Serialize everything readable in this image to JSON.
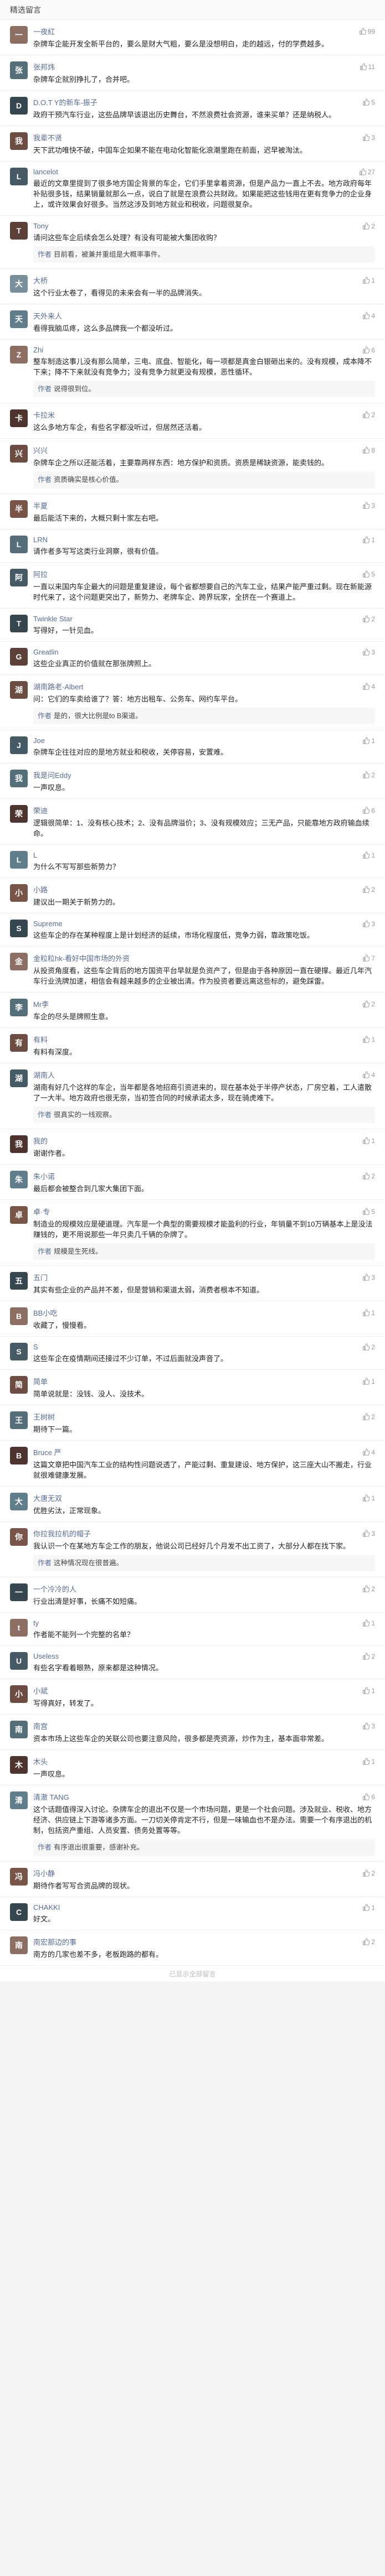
{
  "header": {
    "title": "精选留言"
  },
  "comments": [
    {
      "id": 1,
      "nickname": "一夜紅",
      "avatar_color": "#8d6e63",
      "avatar_text": "一",
      "likes": "99",
      "text": "杂牌车企能开发全新平台的，要么是财大气粗，要么是没想明白，走的越远，付的学费越多。"
    },
    {
      "id": 2,
      "nickname": "张邦炜",
      "avatar_color": "#546e7a",
      "avatar_text": "张",
      "likes": "11",
      "text": "杂牌车企就别挣扎了，合并吧。"
    },
    {
      "id": 3,
      "nickname": "D.O.T Y的新车-振子",
      "avatar_color": "#37474f",
      "avatar_text": "D",
      "likes": "5",
      "text": "政府干预汽车行业，这些品牌早该退出历史舞台，不然浪费社会资源，谁来买单？还是纳税人。"
    },
    {
      "id": 4,
      "nickname": "我辈不贤",
      "avatar_color": "#6d4c41",
      "avatar_text": "我",
      "likes": "3",
      "text": "天下武功唯快不破，中国车企如果不能在电动化智能化浪潮里跑在前面，迟早被淘汰。"
    },
    {
      "id": 5,
      "nickname": "lancelot",
      "avatar_color": "#455a64",
      "avatar_text": "L",
      "likes": "27",
      "text": "最近的文章里提到了很多地方国企背景的车企，它们手里拿着资源，但是产品力一直上不去。地方政府每年补贴很多钱，结果销量就那么一点，说白了就是在浪费公共财政。如果能把这些钱用在更有竞争力的企业身上，或许效果会好很多。当然这涉及到地方就业和税收，问题很复杂。"
    },
    {
      "id": 6,
      "nickname": "Tony",
      "avatar_color": "#5d4037",
      "avatar_text": "T",
      "likes": "2",
      "text": "请问这些车企后续会怎么处理？有没有可能被大集团收购？",
      "author_reply": "目前看，被兼并重组是大概率事件。"
    },
    {
      "id": 7,
      "nickname": "大桥",
      "avatar_color": "#78909c",
      "avatar_text": "大",
      "likes": "1",
      "text": "这个行业太卷了，看得见的未来会有一半的品牌消失。"
    },
    {
      "id": 8,
      "nickname": "天外来人",
      "avatar_color": "#607d8b",
      "avatar_text": "天",
      "likes": "4",
      "text": "看得我脑瓜疼，这么多品牌我一个都没听过。"
    },
    {
      "id": 9,
      "nickname": "Zhi",
      "avatar_color": "#8d6e63",
      "avatar_text": "Z",
      "likes": "6",
      "text": "整车制造这事儿没有那么简单，三电、底盘、智能化，每一项都是真金白银砸出来的。没有规模，成本降不下来；降不下来就没有竞争力；没有竞争力就更没有规模，恶性循环。",
      "author_reply": "说得很到位。"
    },
    {
      "id": 10,
      "nickname": "卡拉米",
      "avatar_color": "#4e342e",
      "avatar_text": "卡",
      "likes": "2",
      "text": "这么多地方车企，有些名字都没听过，但居然还活着。"
    },
    {
      "id": 11,
      "nickname": "兴兴",
      "avatar_color": "#6d4c41",
      "avatar_text": "兴",
      "likes": "8",
      "text": "杂牌车企之所以还能活着，主要靠两样东西：地方保护和资质。资质是稀缺资源，能卖钱的。",
      "author_reply": "资质确实是核心价值。"
    },
    {
      "id": 12,
      "nickname": "半夏",
      "avatar_color": "#795548",
      "avatar_text": "半",
      "likes": "3",
      "text": "最后能活下来的，大概只剩十家左右吧。"
    },
    {
      "id": 13,
      "nickname": "LRN",
      "avatar_color": "#546e7a",
      "avatar_text": "L",
      "likes": "1",
      "text": "请作者多写写这类行业洞察，很有价值。"
    },
    {
      "id": 14,
      "nickname": "阿拉",
      "avatar_color": "#455a64",
      "avatar_text": "阿",
      "likes": "5",
      "text": "一直以来国内车企最大的问题是重复建设，每个省都想要自己的汽车工业，结果产能严重过剩。现在新能源时代来了，这个问题更突出了，新势力、老牌车企、跨界玩家，全挤在一个赛道上。"
    },
    {
      "id": 15,
      "nickname": "Twinkle Star",
      "avatar_color": "#37474f",
      "avatar_text": "T",
      "likes": "2",
      "text": "写得好，一针见血。"
    },
    {
      "id": 16,
      "nickname": "Greatlin",
      "avatar_color": "#5d4037",
      "avatar_text": "G",
      "likes": "3",
      "text": "这些企业真正的价值就在那张牌照上。"
    },
    {
      "id": 17,
      "nickname": "湖南路老·Albert",
      "avatar_color": "#6d4c41",
      "avatar_text": "湖",
      "likes": "4",
      "text": "问：它们的车卖给谁了？答：地方出租车、公务车、网约车平台。",
      "author_reply": "是的，很大比例是to B渠道。"
    },
    {
      "id": 18,
      "nickname": "Joe",
      "avatar_color": "#455a64",
      "avatar_text": "J",
      "likes": "1",
      "text": "杂牌车企往往对应的是地方就业和税收，关停容易，安置难。"
    },
    {
      "id": 19,
      "nickname": "我是问Eddy",
      "avatar_color": "#546e7a",
      "avatar_text": "我",
      "likes": "2",
      "text": "一声叹息。"
    },
    {
      "id": 20,
      "nickname": "荣迪",
      "avatar_color": "#4e342e",
      "avatar_text": "荣",
      "likes": "6",
      "text": "逻辑很简单：1、没有核心技术；2、没有品牌溢价；3、没有规模效应；三无产品，只能靠地方政府输血续命。"
    },
    {
      "id": 21,
      "nickname": "L",
      "avatar_color": "#607d8b",
      "avatar_text": "L",
      "likes": "1",
      "text": "为什么不写写那些新势力？"
    },
    {
      "id": 22,
      "nickname": "小路",
      "avatar_color": "#795548",
      "avatar_text": "小",
      "likes": "2",
      "text": "建议出一期关于新势力的。"
    },
    {
      "id": 23,
      "nickname": "Supreme",
      "avatar_color": "#37474f",
      "avatar_text": "S",
      "likes": "3",
      "text": "这些车企的存在某种程度上是计划经济的延续，市场化程度低，竞争力弱，靠政策吃饭。"
    },
    {
      "id": 24,
      "nickname": "金粒粒hk-看好中国市场的外资",
      "avatar_color": "#8d6e63",
      "avatar_text": "金",
      "likes": "7",
      "text": "从投资角度看，这些车企背后的地方国资平台早就是负资产了，但是由于各种原因一直在硬撑。最近几年汽车行业洗牌加速，相信会有越来越多的企业被出清。作为投资者要远离这些标的，避免踩雷。"
    },
    {
      "id": 25,
      "nickname": "Mr李",
      "avatar_color": "#546e7a",
      "avatar_text": "李",
      "likes": "2",
      "text": "车企的尽头是牌照生意。"
    },
    {
      "id": 26,
      "nickname": "有料",
      "avatar_color": "#6d4c41",
      "avatar_text": "有",
      "likes": "1",
      "text": "有料有深度。"
    },
    {
      "id": 27,
      "nickname": "湖南人",
      "avatar_color": "#455a64",
      "avatar_text": "湖",
      "likes": "4",
      "text": "湖南有好几个这样的车企，当年都是各地招商引资进来的，现在基本处于半停产状态，厂房空着，工人遣散了一大半。地方政府也很无奈，当初签合同的时候承诺太多，现在骑虎难下。",
      "author_reply": "很真实的一线观察。"
    },
    {
      "id": 28,
      "nickname": "我的",
      "avatar_color": "#4e342e",
      "avatar_text": "我",
      "likes": "1",
      "text": "谢谢作者。"
    },
    {
      "id": 29,
      "nickname": "朱小诺",
      "avatar_color": "#607d8b",
      "avatar_text": "朱",
      "likes": "2",
      "text": "最后都会被整合到几家大集团下面。"
    },
    {
      "id": 30,
      "nickname": "卓·专",
      "avatar_color": "#795548",
      "avatar_text": "卓",
      "likes": "5",
      "text": "制造业的规模效应是硬道理。汽车是一个典型的需要规模才能盈利的行业，年销量不到10万辆基本上是没法赚钱的，更不用说那些一年只卖几千辆的杂牌了。",
      "author_reply": "规模是生死线。"
    },
    {
      "id": 31,
      "nickname": "五门",
      "avatar_color": "#37474f",
      "avatar_text": "五",
      "likes": "3",
      "text": "其实有些企业的产品并不差，但是营销和渠道太弱，消费者根本不知道。"
    },
    {
      "id": 32,
      "nickname": "BB小吃",
      "avatar_color": "#8d6e63",
      "avatar_text": "B",
      "likes": "1",
      "text": "收藏了，慢慢看。"
    },
    {
      "id": 33,
      "nickname": "S",
      "avatar_color": "#455a64",
      "avatar_text": "S",
      "likes": "2",
      "text": "这些车企在疫情期间还接过不少订单，不过后面就没声音了。"
    },
    {
      "id": 34,
      "nickname": "简单",
      "avatar_color": "#6d4c41",
      "avatar_text": "简",
      "likes": "1",
      "text": "简单说就是：没钱、没人、没技术。"
    },
    {
      "id": 35,
      "nickname": "王树树",
      "avatar_color": "#546e7a",
      "avatar_text": "王",
      "likes": "2",
      "text": "期待下一篇。"
    },
    {
      "id": 36,
      "nickname": "Bruce 严",
      "avatar_color": "#4e342e",
      "avatar_text": "B",
      "likes": "4",
      "text": "这篇文章把中国汽车工业的结构性问题说透了，产能过剩、重复建设、地方保护，这三座大山不搬走，行业就很难健康发展。"
    },
    {
      "id": 37,
      "nickname": "大唐无双",
      "avatar_color": "#607d8b",
      "avatar_text": "大",
      "likes": "1",
      "text": "优胜劣汰，正常现象。"
    },
    {
      "id": 38,
      "nickname": "你拉我拉机的帽子",
      "avatar_color": "#795548",
      "avatar_text": "你",
      "likes": "3",
      "text": "我认识一个在某地方车企工作的朋友，他说公司已经好几个月发不出工资了，大部分人都在找下家。",
      "author_reply": "这种情况现在很普遍。"
    },
    {
      "id": 39,
      "nickname": "一个冷冷的人",
      "avatar_color": "#37474f",
      "avatar_text": "一",
      "likes": "2",
      "text": "行业出清是好事，长痛不如短痛。"
    },
    {
      "id": 40,
      "nickname": "ty",
      "avatar_color": "#8d6e63",
      "avatar_text": "t",
      "likes": "1",
      "text": "作者能不能列一个完整的名单？"
    },
    {
      "id": 41,
      "nickname": "Useless",
      "avatar_color": "#455a64",
      "avatar_text": "U",
      "likes": "2",
      "text": "有些名字看着眼熟，原来都是这种情况。"
    },
    {
      "id": 42,
      "nickname": "小斌",
      "avatar_color": "#6d4c41",
      "avatar_text": "小",
      "likes": "1",
      "text": "写得真好，转发了。"
    },
    {
      "id": 43,
      "nickname": "南宫",
      "avatar_color": "#546e7a",
      "avatar_text": "南",
      "likes": "3",
      "text": "资本市场上这些车企的关联公司也要注意风险，很多都是壳资源，炒作为主，基本面非常差。"
    },
    {
      "id": 44,
      "nickname": "木头",
      "avatar_color": "#4e342e",
      "avatar_text": "木",
      "likes": "1",
      "text": "一声叹息。"
    },
    {
      "id": 45,
      "nickname": "清澈 TANG",
      "avatar_color": "#607d8b",
      "avatar_text": "清",
      "likes": "6",
      "text": "这个话题值得深入讨论。杂牌车企的退出不仅是一个市场问题，更是一个社会问题。涉及就业、税收、地方经济、供应链上下游等诸多方面。一刀切关停肯定不行，但是一味输血也不是办法。需要一个有序退出的机制，包括资产重组、人员安置、债务处置等等。",
      "author_reply": "有序退出很重要，感谢补充。"
    },
    {
      "id": 46,
      "nickname": "冯小静",
      "avatar_color": "#795548",
      "avatar_text": "冯",
      "likes": "2",
      "text": "期待作者写写合资品牌的现状。"
    },
    {
      "id": 47,
      "nickname": "CHAKKI",
      "avatar_color": "#37474f",
      "avatar_text": "C",
      "likes": "1",
      "text": "好文。"
    },
    {
      "id": 48,
      "nickname": "南宏那边的事",
      "avatar_color": "#8d6e63",
      "avatar_text": "南",
      "likes": "2",
      "text": "南方的几家也差不多，老板跑路的都有。"
    }
  ],
  "labels": {
    "reply": "回复",
    "author_tag": "作者"
  },
  "footer": {
    "text": "已显示全部留言"
  },
  "colors": {
    "nickname": "#576b95",
    "divider": "#efefef",
    "background": "#ffffff"
  }
}
